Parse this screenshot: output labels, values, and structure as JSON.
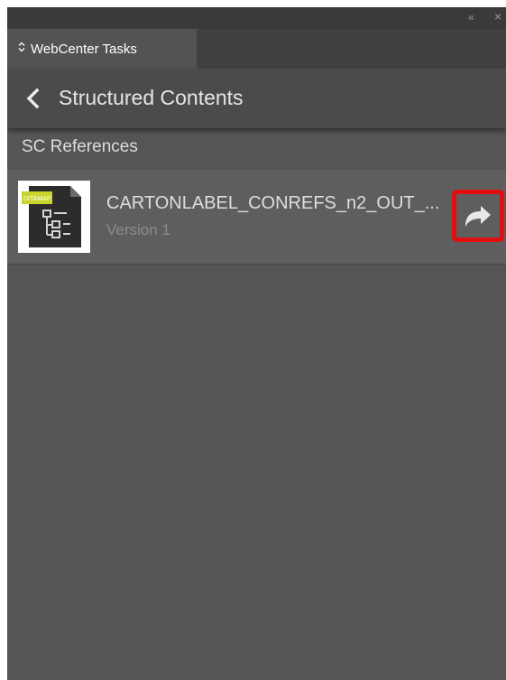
{
  "window": {
    "collapse_glyph": "«",
    "close_glyph": "×"
  },
  "tab": {
    "label": "WebCenter Tasks",
    "icon": "updown-arrows-icon"
  },
  "header": {
    "back_icon": "chevron-left-icon",
    "title": "Structured Contents"
  },
  "section": {
    "label": "SC References"
  },
  "items": [
    {
      "badge": "DITAMAP",
      "title": "CARTONLABEL_CONREFS_n2_OUT_...",
      "subtitle": "Version 1",
      "thumbnail_icon": "ditamap-file-icon",
      "action_icon": "share-arrow-icon",
      "highlight_color": "#e01010"
    }
  ],
  "colors": {
    "panel_bg": "#555555",
    "header_bg": "#4b4b4b",
    "tabbar_bg": "#414141",
    "item_bg": "#5e5e5e",
    "badge_bg": "#c9d42c"
  }
}
